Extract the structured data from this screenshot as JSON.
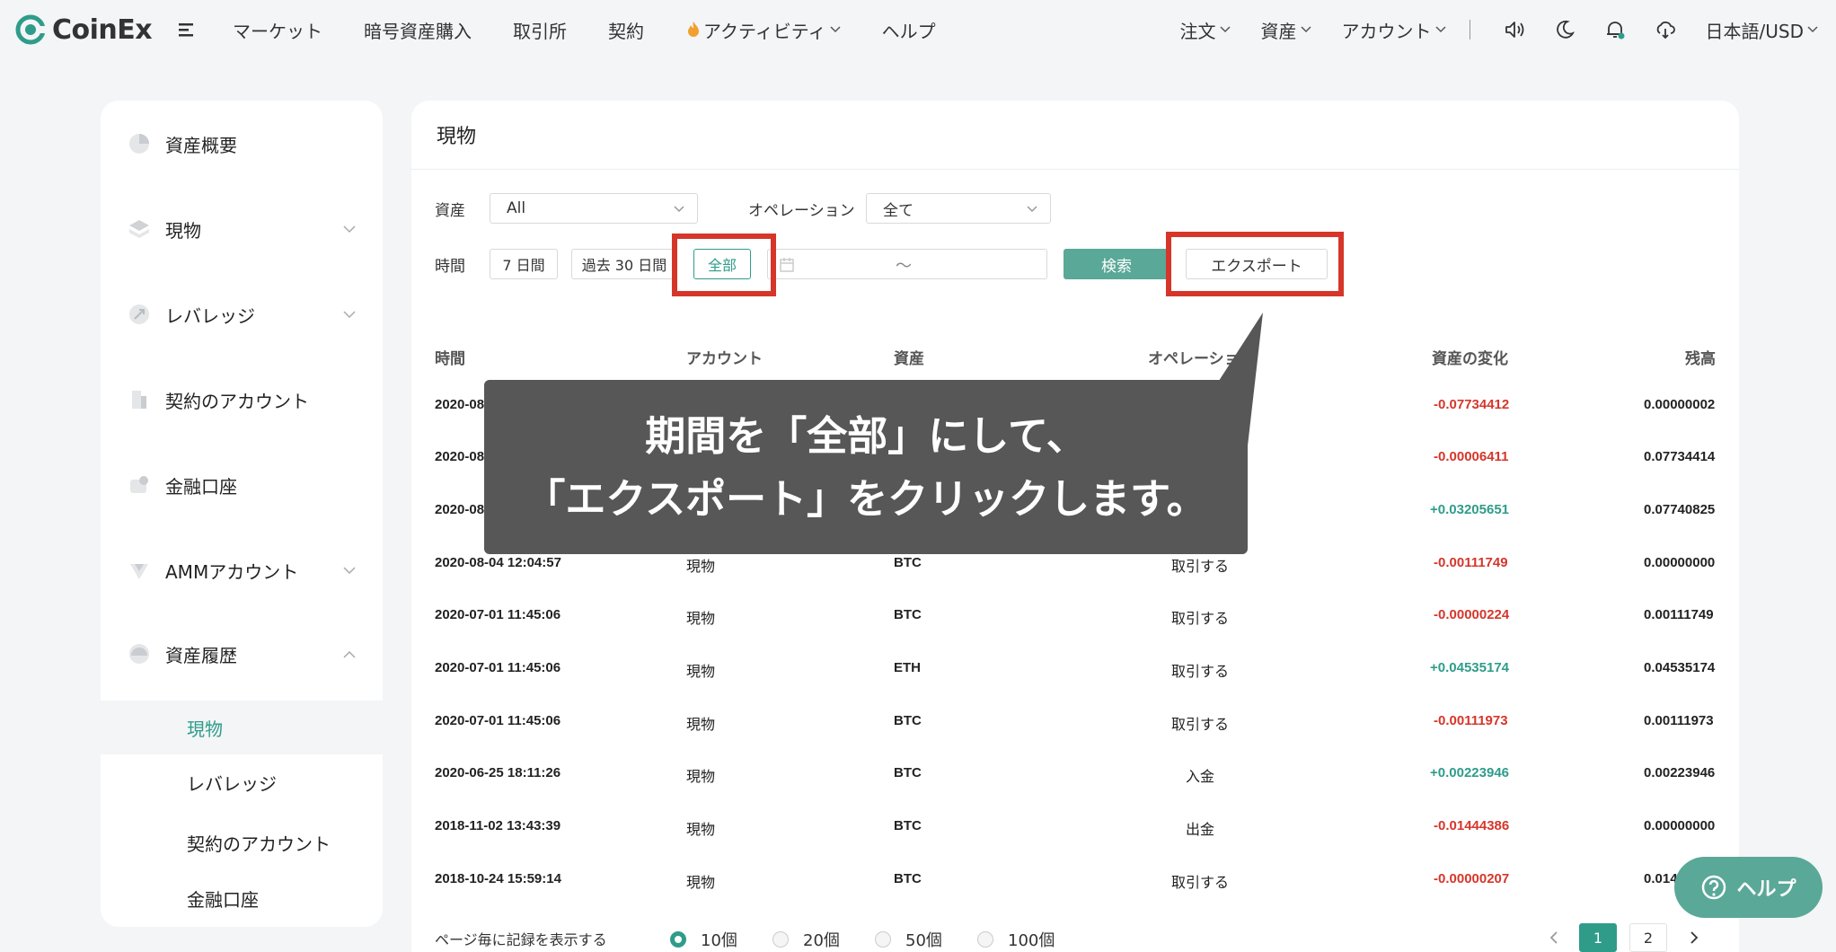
{
  "brand": {
    "name": "CoinEx",
    "color": "#2f9c8a"
  },
  "nav": {
    "items": [
      "マーケット",
      "暗号資産購入",
      "取引所",
      "契約"
    ],
    "activity": "アクティビティ",
    "help": "ヘルプ",
    "orders": "注文",
    "assets": "資産",
    "account": "アカウント",
    "language": "日本語/USD"
  },
  "sidebar": {
    "items": [
      {
        "label": "資産概要",
        "icon": "pie-chart-icon"
      },
      {
        "label": "現物",
        "icon": "layers-icon"
      },
      {
        "label": "レバレッジ",
        "icon": "leverage-icon"
      },
      {
        "label": "契約のアカウント",
        "icon": "contract-icon"
      },
      {
        "label": "金融口座",
        "icon": "finance-icon"
      },
      {
        "label": "AMMアカウント",
        "icon": "amm-icon"
      },
      {
        "label": "資産履歴",
        "icon": "history-icon"
      }
    ],
    "history_sub": [
      "現物",
      "レバレッジ",
      "契約のアカウント",
      "金融口座"
    ]
  },
  "main": {
    "title": "現物",
    "filters": {
      "asset_label": "資産",
      "asset_value": "All",
      "operation_label": "オペレーション",
      "operation_value": "全て",
      "time_label": "時間",
      "time_7d": "7 日間",
      "time_30d": "過去 30 日間",
      "time_all": "全部",
      "date_sep": "～",
      "search": "検索",
      "export": "エクスポート"
    },
    "columns": [
      "時間",
      "アカウント",
      "資産",
      "オペレーション",
      "資産の変化",
      "残高"
    ],
    "rows": [
      {
        "time": "2020-08",
        "account": "",
        "asset": "",
        "operation": "",
        "change": "-0.07734412",
        "balance": "0.00000002"
      },
      {
        "time": "2020-08",
        "account": "",
        "asset": "",
        "operation": "",
        "change": "-0.00006411",
        "balance": "0.07734414"
      },
      {
        "time": "2020-08",
        "account": "",
        "asset": "",
        "operation": "",
        "change": "+0.03205651",
        "balance": "0.07740825"
      },
      {
        "time": "2020-08-04 12:04:57",
        "account": "現物",
        "asset": "BTC",
        "operation": "取引する",
        "change": "-0.00111749",
        "balance": "0.00000000"
      },
      {
        "time": "2020-07-01 11:45:06",
        "account": "現物",
        "asset": "BTC",
        "operation": "取引する",
        "change": "-0.00000224",
        "balance": "0.00111749"
      },
      {
        "time": "2020-07-01 11:45:06",
        "account": "現物",
        "asset": "ETH",
        "operation": "取引する",
        "change": "+0.04535174",
        "balance": "0.04535174"
      },
      {
        "time": "2020-07-01 11:45:06",
        "account": "現物",
        "asset": "BTC",
        "operation": "取引する",
        "change": "-0.00111973",
        "balance": "0.00111973"
      },
      {
        "time": "2020-06-25 18:11:26",
        "account": "現物",
        "asset": "BTC",
        "operation": "入金",
        "change": "+0.00223946",
        "balance": "0.00223946"
      },
      {
        "time": "2018-11-02 13:43:39",
        "account": "現物",
        "asset": "BTC",
        "operation": "出金",
        "change": "-0.01444386",
        "balance": "0.00000000"
      },
      {
        "time": "2018-10-24 15:59:14",
        "account": "現物",
        "asset": "BTC",
        "operation": "取引する",
        "change": "-0.00000207",
        "balance": "0.014"
      }
    ],
    "per_page_label": "ページ毎に記録を表示する",
    "per_page_options": [
      "10個",
      "20個",
      "50個",
      "100個"
    ],
    "pages": [
      "1",
      "2"
    ]
  },
  "callout": {
    "line1": "期間を「全部」にして、",
    "line2": "「エクスポート」をクリックします。"
  },
  "help_button": "ヘルプ",
  "colors": {
    "negative": "#d6362a",
    "positive": "#2f9c8a",
    "highlight": "#d6362a",
    "callout_bg": "#575757"
  }
}
